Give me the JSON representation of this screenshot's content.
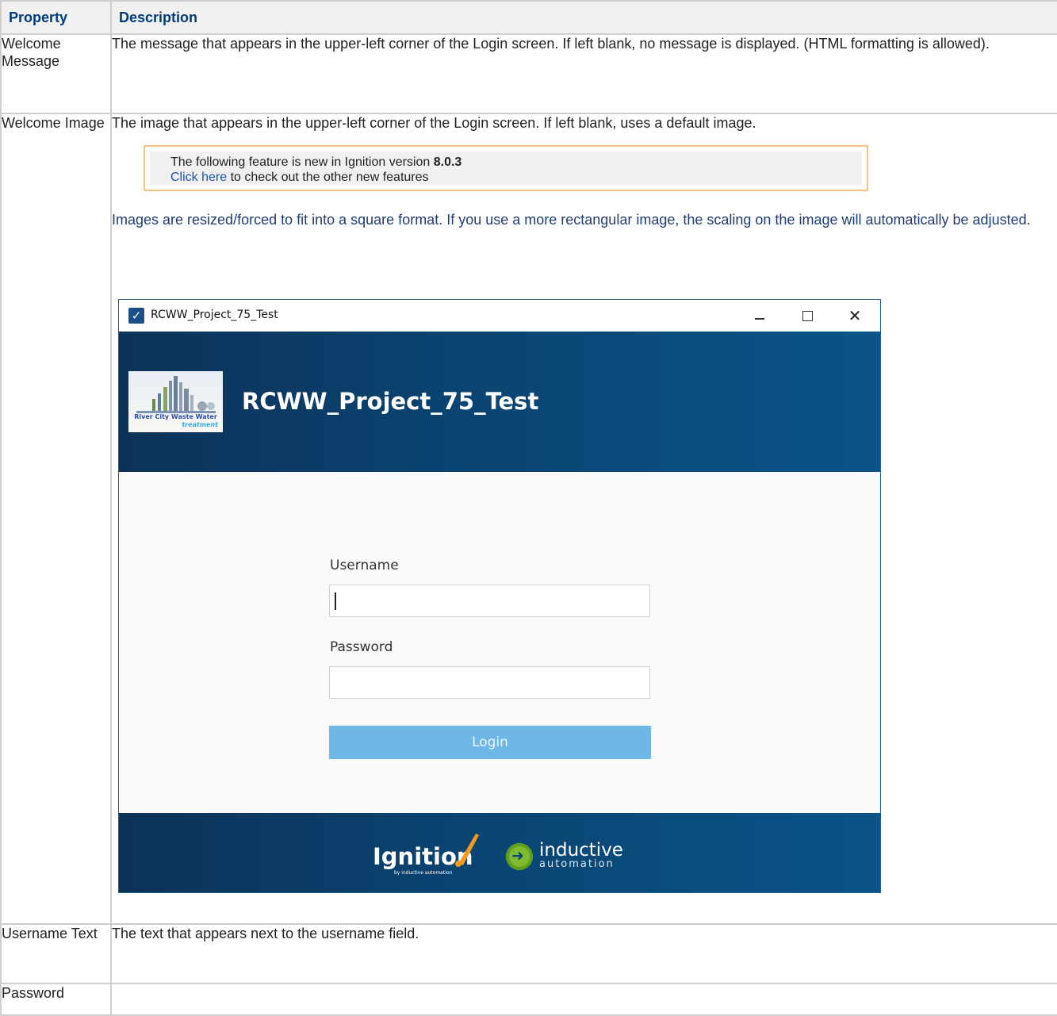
{
  "table": {
    "headers": {
      "property": "Property",
      "description": "Description"
    },
    "rows": [
      {
        "property": "Welcome Message",
        "description": "The message that appears in the upper-left corner of the Login screen. If left blank, no message is displayed. (HTML formatting is allowed)."
      },
      {
        "property": "Welcome Image",
        "description": "The image that appears in the upper-left corner of the Login screen. If left blank, uses a default image."
      },
      {
        "property": "Username Text",
        "description": "The text that appears next to the username field."
      },
      {
        "property": "Password",
        "description": ""
      }
    ]
  },
  "info_panel": {
    "text_prefix": "The following feature is new in Ignition version ",
    "version": "8.0.3",
    "link_text": "Click here",
    "link_suffix": " to check out the other new features"
  },
  "note": "Images are resized/forced to fit into a square format. If you use a more rectangular image, the scaling on the image will automatically be adjusted.",
  "login_window": {
    "window_title": "RCWW_Project_75_Test",
    "banner_title": "RCWW_Project_75_Test",
    "logo_line1": "River City Waste Water",
    "logo_line2": "treatment",
    "username_label": "Username",
    "password_label": "Password",
    "login_button": "Login",
    "footer_ignition": "Ignition",
    "footer_ignition_sub": "by inductive automation",
    "footer_inductive": "inductive",
    "footer_automation": "automation",
    "accent_color": "#0a4472",
    "button_color": "#6fb8e6"
  }
}
